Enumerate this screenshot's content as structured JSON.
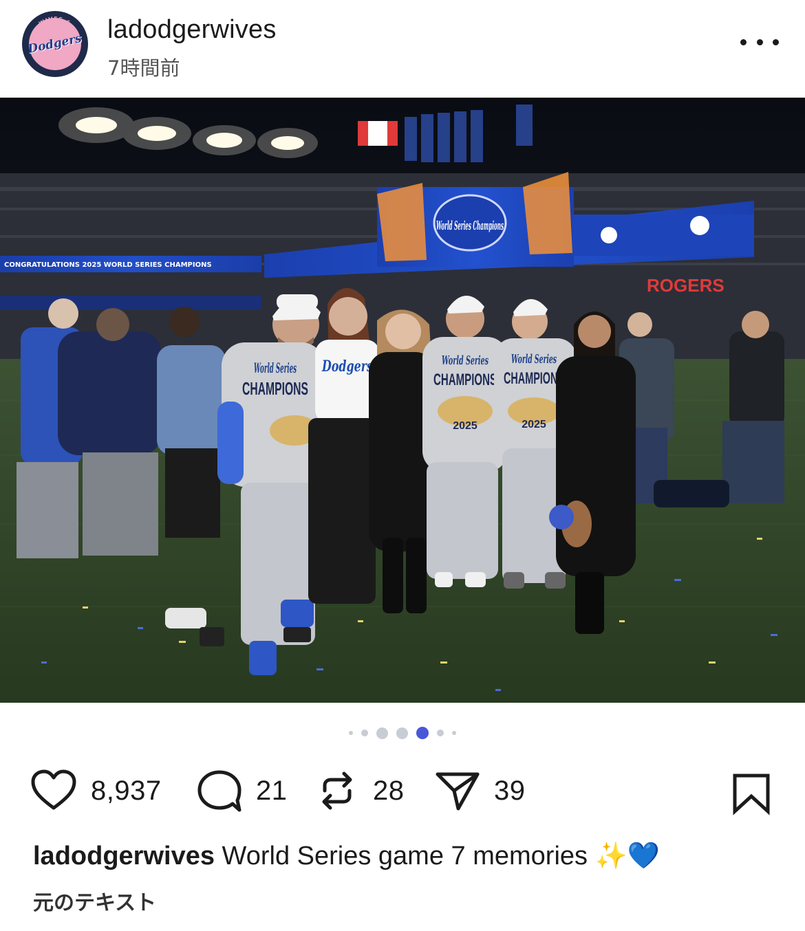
{
  "post": {
    "username": "ladodgerwives",
    "timestamp": "7時間前",
    "avatar": {
      "logo_text": "Dodgers",
      "ring_top": "WIVES &",
      "ring_bottom": "GIRLFRIENDS",
      "bg_color": "#f0a8c4",
      "ring_color": "#1f2a4a"
    },
    "more_icon": "ellipsis-icon"
  },
  "photo": {
    "stadium_banner_main": "World Series Champions",
    "banner_congrats": "CONGRATULATIONS 2025 WORLD SERIES CHAMPIONS",
    "sponsor": "ROGERS",
    "tshirt_line1": "World Series",
    "tshirt_line2": "CHAMPIONS",
    "tshirt_year": "2025",
    "jersey_text": "Dodgers"
  },
  "carousel": {
    "total": 7,
    "active_index": 4
  },
  "actions": {
    "like": {
      "icon": "heart-icon",
      "count": "8,937"
    },
    "comment": {
      "icon": "comment-icon",
      "count": "21"
    },
    "repost": {
      "icon": "repost-icon",
      "count": "28"
    },
    "share": {
      "icon": "send-icon",
      "count": "39"
    },
    "save": {
      "icon": "bookmark-icon"
    }
  },
  "caption": {
    "username": "ladodgerwives",
    "text": "World Series game 7 memories",
    "emojis": "✨💙"
  },
  "translate_link": "元のテキスト",
  "colors": {
    "accent": "#4a57d8",
    "dot_inactive": "#c8ccd4",
    "dodger_blue": "#1e4fb0",
    "field_green": "#2f4a2a"
  }
}
